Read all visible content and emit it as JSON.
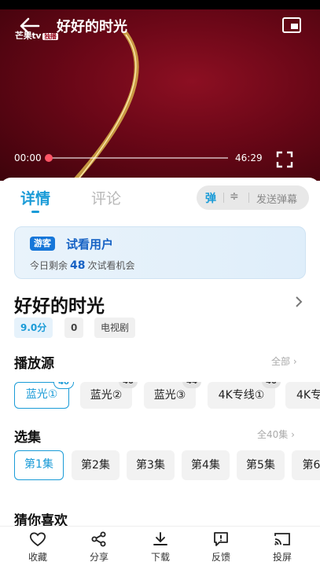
{
  "player": {
    "title": "好好的时光",
    "logo_text": "芒果tv",
    "logo_badge": "独播",
    "current_time": "00:00",
    "total_time": "46:29",
    "progress": 0.0
  },
  "tabs": [
    {
      "label": "详情",
      "active": true
    },
    {
      "label": "评论",
      "active": false
    }
  ],
  "danmu": {
    "toggle_label": "弹",
    "settings_glyph": "≑",
    "send_label": "发送弹幕"
  },
  "trial": {
    "badge": "游客",
    "title": "试看用户",
    "desc_prefix": "今日剩余",
    "count": "48",
    "desc_suffix": "次试看机会"
  },
  "show": {
    "title": "好好的时光",
    "score": "9.0分",
    "count": "0",
    "genre": "电视剧"
  },
  "sources": {
    "title": "播放源",
    "more": "全部",
    "items": [
      {
        "label": "蓝光①",
        "badge": "40",
        "active": true
      },
      {
        "label": "蓝光②",
        "badge": "40",
        "active": false
      },
      {
        "label": "蓝光③",
        "badge": "44",
        "active": false
      },
      {
        "label": "4K专线①",
        "badge": "40",
        "active": false
      },
      {
        "label": "4K专",
        "badge": "",
        "active": false
      }
    ]
  },
  "episodes": {
    "title": "选集",
    "more": "全40集",
    "items": [
      {
        "label": "第1集",
        "active": true
      },
      {
        "label": "第2集",
        "active": false
      },
      {
        "label": "第3集",
        "active": false
      },
      {
        "label": "第4集",
        "active": false
      },
      {
        "label": "第5集",
        "active": false
      },
      {
        "label": "第6",
        "active": false
      }
    ]
  },
  "guess": {
    "title": "猜你喜欢"
  },
  "bottom_bar": [
    {
      "label": "收藏",
      "icon": "heart-icon"
    },
    {
      "label": "分享",
      "icon": "share-icon"
    },
    {
      "label": "下载",
      "icon": "download-icon"
    },
    {
      "label": "反馈",
      "icon": "feedback-icon"
    },
    {
      "label": "投屏",
      "icon": "cast-icon"
    }
  ],
  "colors": {
    "accent": "#1a9bd7",
    "player_bg": "#6a0717",
    "progress_knob": "#ff5566",
    "trial_blue": "#1662c4"
  }
}
